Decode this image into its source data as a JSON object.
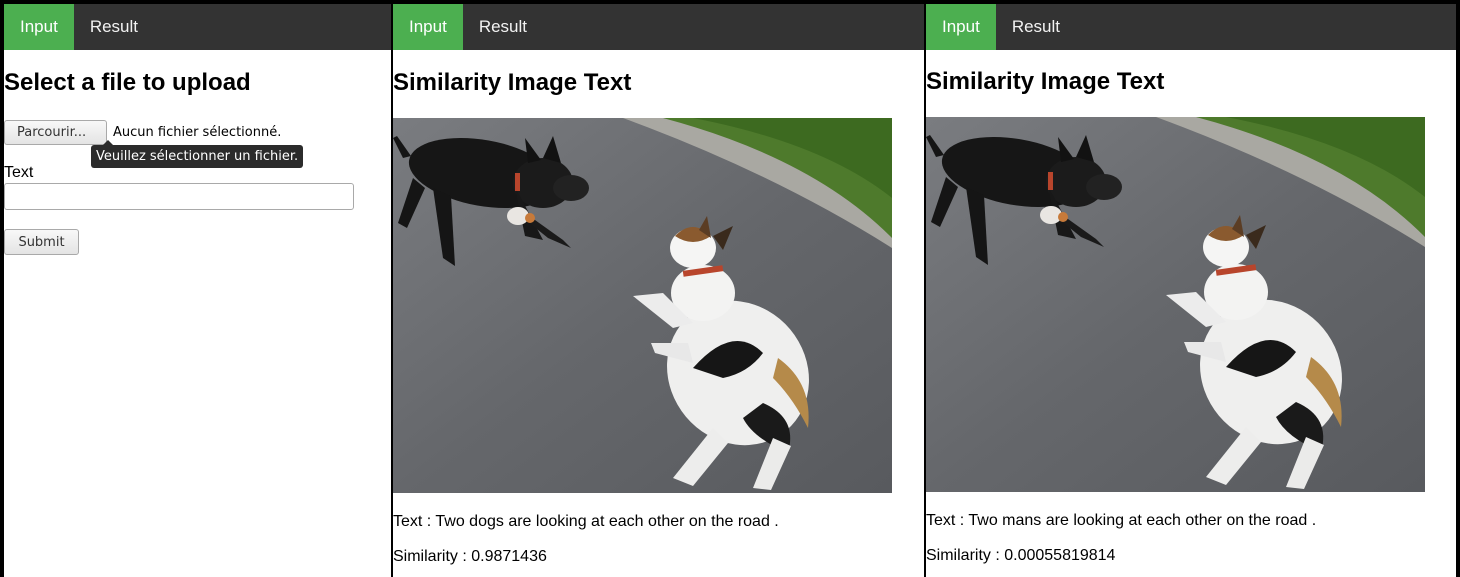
{
  "tabs": {
    "input": "Input",
    "result": "Result"
  },
  "upload_panel": {
    "heading": "Select a file to upload",
    "browse_label": "Parcourir...",
    "file_status": "Aucun fichier sélectionné.",
    "tooltip": "Veuillez sélectionner un fichier.",
    "text_label": "Text",
    "text_value": "",
    "submit_label": "Submit"
  },
  "results": [
    {
      "heading": "Similarity Image Text",
      "text_line": "Text : Two dogs are looking at each other on the road .",
      "similarity_line": "Similarity : 0.9871436",
      "image": "photo of a black dog and a white-and-brown dog facing each other on a paved road"
    },
    {
      "heading": "Similarity Image Text",
      "text_line": "Text : Two mans are looking at each other on the road .",
      "similarity_line": "Similarity : 0.00055819814",
      "image": "photo of a black dog and a white-and-brown dog facing each other on a paved road"
    }
  ]
}
